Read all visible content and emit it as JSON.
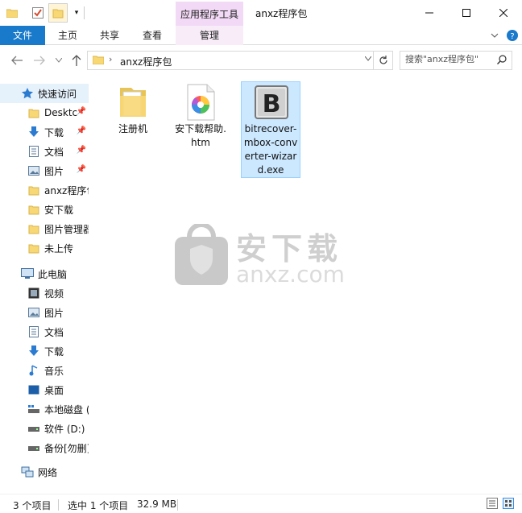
{
  "window": {
    "title": "anxz程序包",
    "context_tab_header": "应用程序工具"
  },
  "ribbon": {
    "tabs": [
      "文件",
      "主页",
      "共享",
      "查看",
      "管理"
    ]
  },
  "address": {
    "path": "anxz程序包",
    "search_placeholder": "搜索\"anxz程序包\""
  },
  "sidebar": {
    "quick_access": "快速访问",
    "items": [
      {
        "label": "Desktc",
        "icon": "folder-icon"
      },
      {
        "label": "下载",
        "icon": "download-icon"
      },
      {
        "label": "文档",
        "icon": "document-icon"
      },
      {
        "label": "图片",
        "icon": "picture-icon"
      },
      {
        "label": "anxz程序包",
        "icon": "folder-icon"
      },
      {
        "label": "安下载",
        "icon": "folder-icon"
      },
      {
        "label": "图片管理器",
        "icon": "folder-icon"
      },
      {
        "label": "未上传",
        "icon": "folder-icon"
      }
    ],
    "this_pc": "此电脑",
    "pc_items": [
      {
        "label": "视频",
        "icon": "video-icon"
      },
      {
        "label": "图片",
        "icon": "picture-icon"
      },
      {
        "label": "文档",
        "icon": "document-icon"
      },
      {
        "label": "下载",
        "icon": "download-icon"
      },
      {
        "label": "音乐",
        "icon": "music-icon"
      },
      {
        "label": "桌面",
        "icon": "desktop-icon"
      },
      {
        "label": "本地磁盘 (",
        "icon": "drive-icon"
      },
      {
        "label": "软件 (D:)",
        "icon": "drive-icon"
      },
      {
        "label": "备份[勿删]",
        "icon": "drive-icon"
      }
    ],
    "network": "网络"
  },
  "files": [
    {
      "name": "注册机",
      "icon": "folder-icon",
      "selected": false
    },
    {
      "name": "安下载帮助.htm",
      "icon": "html-file-icon",
      "selected": false
    },
    {
      "name": "bitrecover-mbox-converter-wizard.exe",
      "icon": "exe-file-icon",
      "selected": true
    }
  ],
  "watermark": {
    "text": "安下载",
    "url": "anxz.com"
  },
  "status": {
    "item_count": "3 个项目",
    "selection": "选中 1 个项目",
    "size": "32.9 MB"
  },
  "colors": {
    "file_tab": "#1979ca",
    "context_tab": "#f2d9f5",
    "selection": "#cce8ff",
    "sidebar_selection": "#e5f1fb"
  }
}
